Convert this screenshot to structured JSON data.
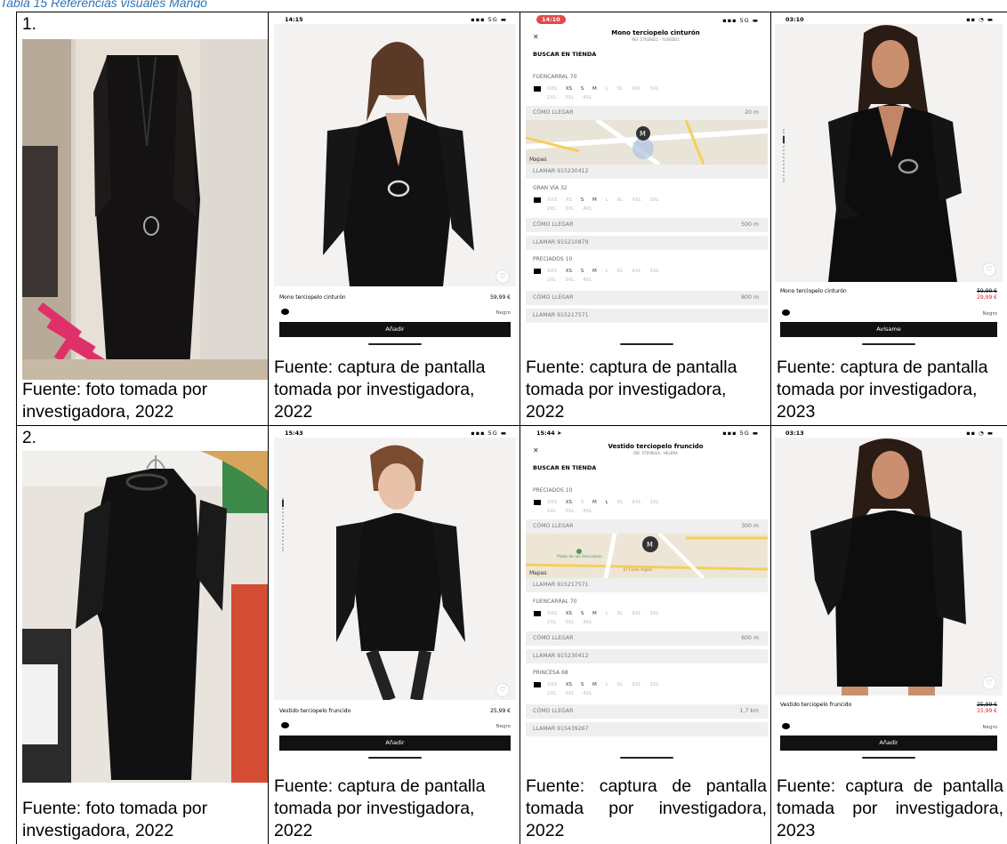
{
  "caption": "Tabla 15 Referencias visuales Mango",
  "rows": [
    {
      "num": "1.",
      "cells": [
        {
          "source": "Fuente: foto tomada por investigadora, 2022"
        },
        {
          "source": "Fuente: captura de pantalla tomada por investigadora, 2022",
          "time": "14:15",
          "signal": "5G",
          "product": "Mono terciopelo cinturón",
          "price": "59,99 €",
          "color": "Negro",
          "button": "Añadir"
        },
        {
          "source": "Fuente: captura de pantalla tomada por investigadora, 2022",
          "time": "14:10",
          "signal": "5G",
          "title": "Mono terciopelo cinturón",
          "ref": "REF. 57029021 - TUXEDO1",
          "buscar": "BUSCAR EN TIENDA",
          "map_label": "Mapas",
          "stores": [
            {
              "name": "FUENCARRAL 70",
              "dist": "20 m",
              "como": "CÓMO LLEGAR",
              "tel": "LLAMAR 915230412"
            },
            {
              "name": "GRAN VÍA 32",
              "dist": "500 m",
              "como": "CÓMO LLEGAR",
              "tel": "LLAMAR 915210879"
            },
            {
              "name": "PRECIADOS 10",
              "dist": "800 m",
              "como": "CÓMO LLEGAR",
              "tel": "LLAMAR 915217571"
            }
          ]
        },
        {
          "source": "Fuente: captura de pantalla tomada por investigadora, 2023",
          "time": "03:10",
          "product": "Mono terciopelo cinturón",
          "old_price": "59,99 €",
          "sale_price": "29,99 €",
          "color": "Negro",
          "button": "Avísame"
        }
      ]
    },
    {
      "num": "2.",
      "cells": [
        {
          "source": "Fuente: foto tomada por investigadora, 2022"
        },
        {
          "source": "Fuente: captura de pantalla tomada por investigadora, 2022",
          "time": "15:43",
          "signal": "5G",
          "product": "Vestido terciopelo fruncido",
          "price": "25,99 €",
          "color": "Negro",
          "button": "Añadir"
        },
        {
          "source": "Fuente: captura de pantalla tomada por investigadora, 2022",
          "time": "15:44",
          "signal": "5G",
          "title": "Vestido terciopelo fruncido",
          "ref": "REF. 57059024 - HELENA",
          "buscar": "BUSCAR EN TIENDA",
          "map_label": "Mapas",
          "map_places": [
            "Plaza de las Descalzas",
            "El Corte Inglés"
          ],
          "stores": [
            {
              "name": "PRECIADOS 10",
              "dist": "300 m",
              "como": "CÓMO LLEGAR",
              "tel": "LLAMAR 915217571"
            },
            {
              "name": "FUENCARRAL 70",
              "dist": "600 m",
              "como": "CÓMO LLEGAR",
              "tel": "LLAMAR 915230412"
            },
            {
              "name": "PRINCESA 68",
              "dist": "1,7 km",
              "como": "CÓMO LLEGAR",
              "tel": "LLAMAR 915439267"
            }
          ]
        },
        {
          "source": "Fuente: captura de pantalla tomada por investigadora, 2023",
          "time": "03:13",
          "product": "Vestido terciopelo fruncido",
          "old_price": "25,99 €",
          "sale_price": "15,99 €",
          "color": "Negro",
          "button": "Añadir"
        }
      ]
    }
  ],
  "sizes": [
    "XXS",
    "XS",
    "S",
    "M",
    "L",
    "XL",
    "XXL",
    "3XL",
    "2XL",
    "3XL",
    "4XL"
  ]
}
